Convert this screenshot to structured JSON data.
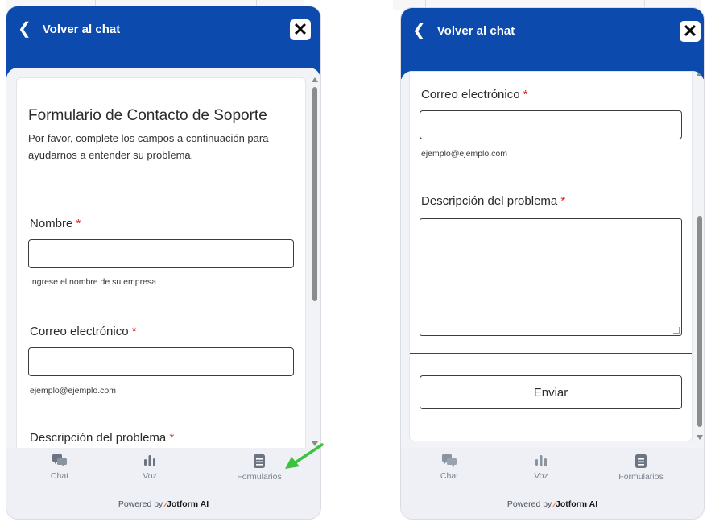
{
  "header": {
    "back_label": "Volver al chat",
    "close_label": "✕"
  },
  "form": {
    "title": "Formulario de Contacto de Soporte",
    "description": "Por favor, complete los campos a continuación para ayudarnos a entender su problema.",
    "name_label": "Nombre",
    "name_hint": "Ingrese el nombre de su empresa",
    "email_label": "Correo electrónico",
    "email_hint": "ejemplo@ejemplo.com",
    "problem_label": "Descripción del problema",
    "required_mark": "*",
    "submit_label": "Enviar"
  },
  "nav": {
    "chat": {
      "label": "Chat",
      "icon": "chat-icon"
    },
    "voice": {
      "label": "Voz",
      "icon": "voice-icon"
    },
    "forms": {
      "label": "Formularios",
      "icon": "form-icon"
    }
  },
  "footer": {
    "powered_prefix": "Powered by",
    "brand": "Jotform AI"
  },
  "colors": {
    "header": "#0c4aad",
    "required": "#e02020",
    "arrow": "#3cc23c"
  }
}
